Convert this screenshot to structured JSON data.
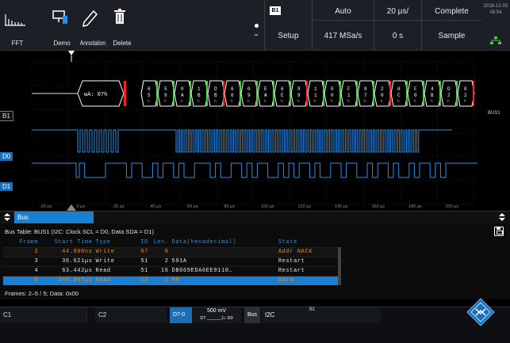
{
  "toolbar": {
    "tools": [
      {
        "label": "FFT",
        "icon": "fft-icon"
      },
      {
        "label": "Demo",
        "icon": "demo-icon"
      },
      {
        "label": "Annotation",
        "icon": "pen-icon"
      },
      {
        "label": "Delete",
        "icon": "trash-icon"
      }
    ],
    "bus_badge": "B1",
    "setup": "Setup",
    "trigger_mode": "Auto",
    "sample_rate": "417 MSa/s",
    "timebase": "20 µs/",
    "position": "0 s",
    "acquisition": "Complete",
    "acq_mode": "Sample",
    "date": "2016-12-05",
    "time": "08:54"
  },
  "waveform": {
    "channels": {
      "bus": "B1",
      "d0": "D0",
      "d1": "D1"
    },
    "bus_right_label": "BUS1",
    "first_frame_label": "wA: 07h",
    "data_bytes": [
      "65",
      "59",
      "0A",
      "1B",
      "DB",
      "66",
      "09",
      "EA",
      "6E",
      "99",
      "11",
      "00",
      "F1",
      "87",
      "20",
      "6C",
      "F0",
      "4B",
      "D2",
      "02"
    ],
    "time_ticks": [
      "-20 µs",
      "0 µs",
      "20 µs",
      "40 µs",
      "60 µs",
      "80 µs",
      "100 µs",
      "120 µs",
      "140 µs",
      "160 µs",
      "180 µs",
      "200 µs"
    ],
    "colors": {
      "digital": "#2a8fe0",
      "bus_data": "#ffffff",
      "address": "#7ad0ff",
      "nack": "#ff2020",
      "ack": "#40d040"
    }
  },
  "bus_panel": {
    "tab_label": "Bus",
    "table_title": "Bus Table: BUS1 (I2C: Clock SCL = D0, Data SDA = D1)",
    "columns": [
      "Frame",
      "Start Time",
      "Type",
      "ID",
      "Len.",
      "Data(hexadecimal)",
      "State"
    ],
    "rows": [
      {
        "frame": "2",
        "start": "44.800ns",
        "type": "Write",
        "id": "07",
        "len": "0",
        "data": "",
        "state": "Addr NACK"
      },
      {
        "frame": "3",
        "start": "36.621µs",
        "type": "Write",
        "id": "51",
        "len": "2",
        "data": "591A",
        "state": "Restart"
      },
      {
        "frame": "4",
        "start": "63.442µs",
        "type": "Read",
        "id": "51",
        "len": "16",
        "data": "DB669EDA6EE9110…",
        "state": "Restart"
      },
      {
        "frame": "5",
        "start": "246.997µs",
        "type": "Read",
        "id": "12",
        "len": "1",
        "data": "00",
        "state": "Data"
      }
    ],
    "frames_info": "Frames: 2–5 / 5; Data: 0x00"
  },
  "channel_bar": {
    "c1": "C1",
    "c2": "C2",
    "d70": "D7-0",
    "d70_value": "500 mV",
    "d70_bits": "D7 ______1↕ D0",
    "bus": "Bus",
    "i2c": "I2C",
    "i2c_badge": "B1"
  }
}
